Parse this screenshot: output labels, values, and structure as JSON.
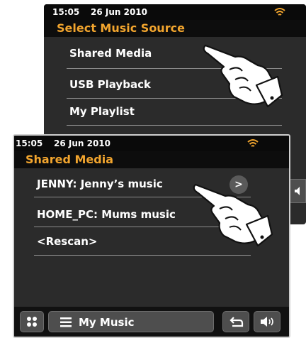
{
  "back_screen": {
    "status": {
      "time": "15:05",
      "date": "26 Jun 2010"
    },
    "title": "Select Music Source",
    "items": [
      {
        "label": "Shared Media"
      },
      {
        "label": "USB Playback"
      },
      {
        "label": "My Playlist"
      }
    ]
  },
  "front_screen": {
    "status": {
      "time": "15:05",
      "date": "26 Jun 2010"
    },
    "title": "Shared Media",
    "items": [
      {
        "label": "JENNY: Jenny’s music",
        "arrow": ">"
      },
      {
        "label": "HOME_PC: Mums music"
      },
      {
        "label": "<Rescan>"
      }
    ],
    "bottom_bar": {
      "menu_label": "My Music"
    }
  },
  "icons": [
    "wifi-icon",
    "grid-icon",
    "menu-lines-icon",
    "back-icon",
    "volume-icon",
    "pointing-hand-icon"
  ],
  "colors": {
    "title": "#f2a52e",
    "wifi": "#f2a52e",
    "screen": "#2b2b2b",
    "status_bar": "#0a0a0a"
  }
}
